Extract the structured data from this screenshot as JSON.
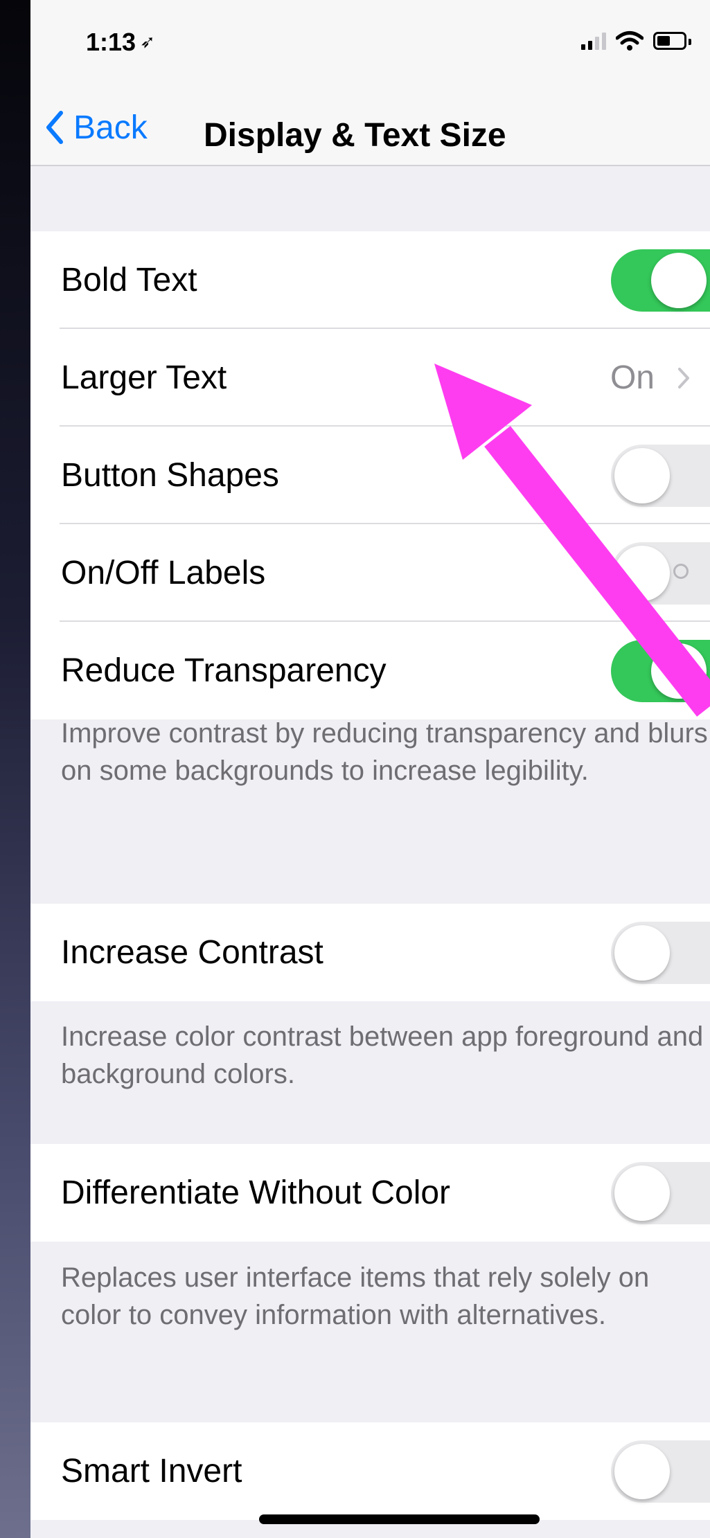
{
  "status_bar": {
    "time": "1:13"
  },
  "nav": {
    "back_label": "Back",
    "title": "Display & Text Size"
  },
  "group1": {
    "rows": [
      {
        "label": "Bold Text",
        "control": "toggle",
        "on": true
      },
      {
        "label": "Larger Text",
        "control": "disclosure",
        "value": "On"
      },
      {
        "label": "Button Shapes",
        "control": "toggle",
        "on": false
      },
      {
        "label": "On/Off Labels",
        "control": "toggle",
        "on": false
      },
      {
        "label": "Reduce Transparency",
        "control": "toggle",
        "on": true
      }
    ],
    "footer": "Improve contrast by reducing transparency and blurs on some backgrounds to increase legibility."
  },
  "group2": {
    "rows": [
      {
        "label": "Increase Contrast",
        "control": "toggle",
        "on": false
      }
    ],
    "footer": "Increase color contrast between app foreground and background colors."
  },
  "group3": {
    "rows": [
      {
        "label": "Differentiate Without Color",
        "control": "toggle",
        "on": false
      }
    ],
    "footer": "Replaces user interface items that rely solely on color to convey information with alternatives."
  },
  "group4": {
    "rows": [
      {
        "label": "Smart Invert",
        "control": "toggle",
        "on": false
      }
    ]
  },
  "colors": {
    "accent": "#0a7aff",
    "toggle_on": "#34c759",
    "annotation_arrow": "#ff3df0"
  },
  "icons": {
    "back": "chevron-left-icon",
    "disclosure": "chevron-right-icon",
    "location": "location-arrow-icon",
    "signal": "cellular-signal-icon",
    "wifi": "wifi-icon",
    "battery": "battery-icon"
  }
}
